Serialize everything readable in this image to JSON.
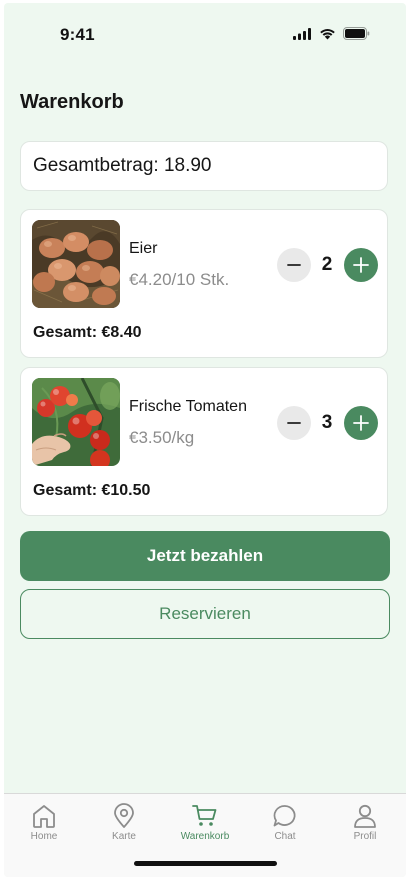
{
  "status_bar": {
    "time": "9:41",
    "icons": [
      "cellular-signal-icon",
      "wifi-icon",
      "battery-icon"
    ]
  },
  "header": {
    "title": "Warenkorb"
  },
  "summary": {
    "total_text": "Gesamtbetrag: 18.90"
  },
  "cart_items": [
    {
      "name": "Eier",
      "unit_price": "€4.20/10 Stk.",
      "quantity": "2",
      "line_total": "Gesamt: €8.40",
      "image": "eggs-photo"
    },
    {
      "name": "Frische Tomaten",
      "unit_price": "€3.50/kg",
      "quantity": "3",
      "line_total": "Gesamt: €10.50",
      "image": "tomatoes-photo"
    }
  ],
  "actions": {
    "pay_label": "Jetzt bezahlen",
    "reserve_label": "Reservieren"
  },
  "tabs": [
    {
      "label": "Home",
      "icon": "home-icon",
      "active": false
    },
    {
      "label": "Karte",
      "icon": "map-pin-icon",
      "active": false
    },
    {
      "label": "Warenkorb",
      "icon": "cart-icon",
      "active": true
    },
    {
      "label": "Chat",
      "icon": "chat-bubble-icon",
      "active": false
    },
    {
      "label": "Profil",
      "icon": "user-icon",
      "active": false
    }
  ],
  "colors": {
    "background": "#eef8f0",
    "accent": "#4a8a60",
    "card": "#ffffff",
    "muted_text": "#8c8c8c",
    "minus_button": "#e9e9e9"
  }
}
